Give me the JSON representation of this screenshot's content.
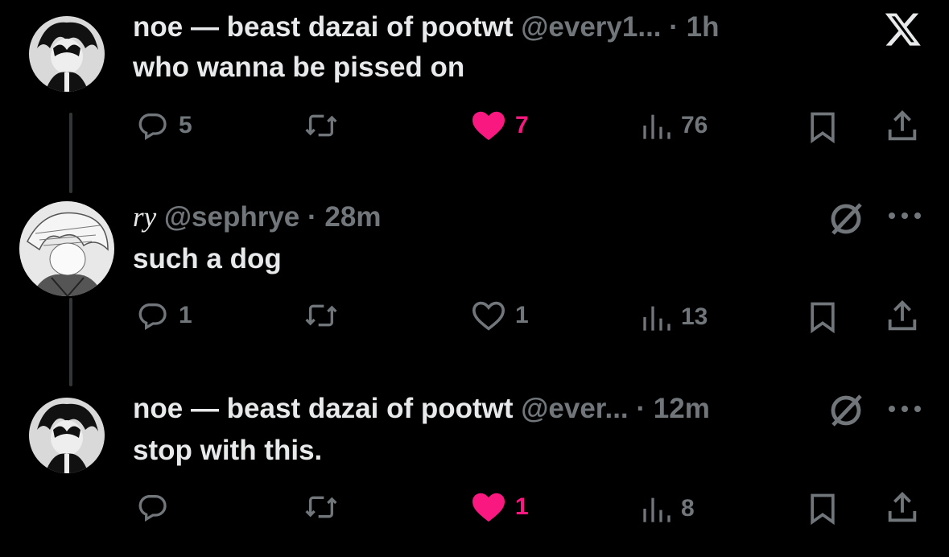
{
  "colors": {
    "background": "#000000",
    "text": "#e7e9ea",
    "muted": "#71767b",
    "like": "#f91880",
    "thread_line": "#333639"
  },
  "tweets": [
    {
      "display_name": "noe — beast dazai of pootwt",
      "handle": "@every1...",
      "separator": "·",
      "time": "1h",
      "text": "who wanna be pissed on",
      "replies": "5",
      "retweets": "",
      "likes": "7",
      "liked": true,
      "views": "76"
    },
    {
      "display_name": "ry",
      "handle": "@sephrye",
      "separator": "·",
      "time": "28m",
      "text": "such a dog",
      "replies": "1",
      "retweets": "",
      "likes": "1",
      "liked": false,
      "views": "13"
    },
    {
      "display_name": "noe — beast dazai of pootwt",
      "handle": "@ever...",
      "separator": "·",
      "time": "12m",
      "text": "stop with this.",
      "replies": "",
      "retweets": "",
      "likes": "1",
      "liked": true,
      "views": "8"
    }
  ],
  "icons": {
    "logo": "x-logo-icon",
    "reply": "reply-icon",
    "retweet": "retweet-icon",
    "like": "heart-icon",
    "views": "views-icon",
    "bookmark": "bookmark-icon",
    "share": "share-icon",
    "grok": "grok-icon",
    "more": "more-icon"
  }
}
